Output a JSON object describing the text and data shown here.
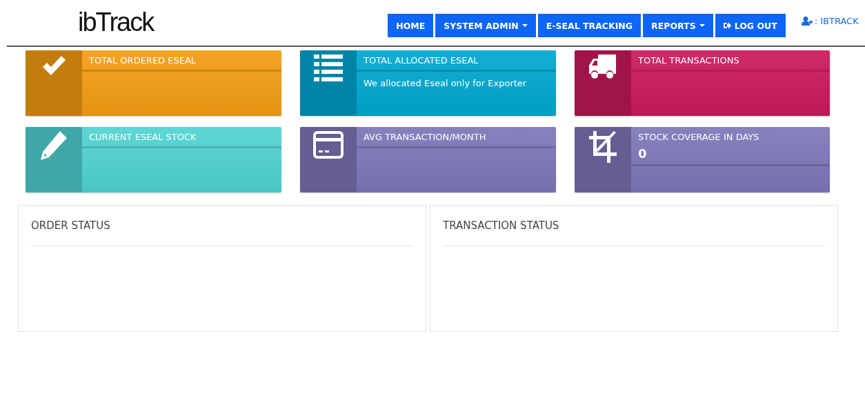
{
  "header": {
    "logo": "ibTrack",
    "nav": [
      {
        "label": "HOME",
        "dropdown": false,
        "kind": "plain"
      },
      {
        "label": "SYSTEM ADMIN",
        "dropdown": true,
        "kind": "plain"
      },
      {
        "label": "E-SEAL TRACKING",
        "dropdown": false,
        "kind": "plain"
      },
      {
        "label": "REPORTS",
        "dropdown": true,
        "kind": "plain"
      },
      {
        "label": "LOG OUT",
        "dropdown": false,
        "kind": "logout"
      }
    ],
    "user": ": IBTRACK"
  },
  "cards": [
    {
      "title": "TOTAL ORDERED ESEAL",
      "color": "#f39c12"
    },
    {
      "title": "TOTAL ALLOCATED ESEAL",
      "note": "We allocated Eseal only for Exporter",
      "color": "#00a7d0"
    },
    {
      "title": "TOTAL TRANSACTIONS",
      "color": "#ca195a"
    },
    {
      "title": "CURRENT ESEAL STOCK",
      "color": "#4fd3d1"
    },
    {
      "title": "AVG TRANSACTION/MONTH",
      "color": "#7d76b8"
    },
    {
      "title": "STOCK COVERAGE IN DAYS",
      "value": "0",
      "color": "#7d76b8"
    }
  ],
  "panels": [
    {
      "title": "ORDER STATUS"
    },
    {
      "title": "TRANSACTION STATUS"
    }
  ]
}
